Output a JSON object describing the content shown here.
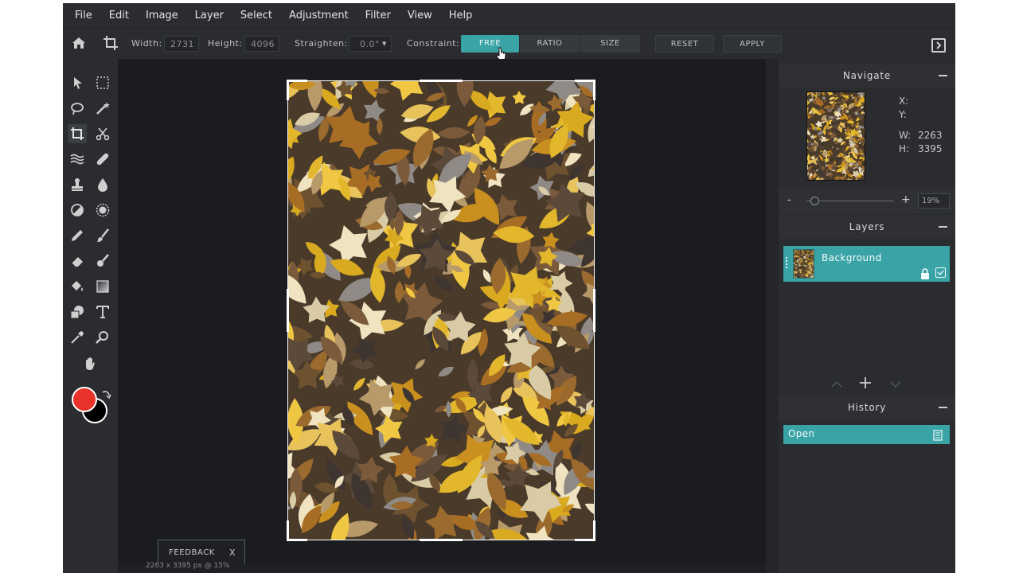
{
  "menu": [
    "File",
    "Edit",
    "Image",
    "Layer",
    "Select",
    "Adjustment",
    "Filter",
    "View",
    "Help"
  ],
  "options": {
    "width_label": "Width:",
    "width_value": "2731",
    "height_label": "Height:",
    "height_value": "4096",
    "straighten_label": "Straighten:",
    "straighten_value": "0.0°",
    "constraint_label": "Constraint:",
    "free": "FREE",
    "ratio": "RATIO",
    "size": "SIZE",
    "reset": "RESET",
    "apply": "APPLY"
  },
  "navigate": {
    "title": "Navigate",
    "x_label": "X:",
    "y_label": "Y:",
    "w_label": "W:",
    "w_value": "2263",
    "h_label": "H:",
    "h_value": "3395",
    "zoom_minus": "-",
    "zoom_plus": "+",
    "zoom_value": "19%",
    "zoom_level": 0.05
  },
  "layers": {
    "title": "Layers",
    "items": [
      {
        "name": "Background",
        "locked": true,
        "visible": true
      }
    ]
  },
  "history": {
    "title": "History",
    "items": [
      "Open"
    ]
  },
  "feedback": {
    "label": "FEEDBACK",
    "close": "X"
  },
  "status": "2263 x 3395 px @ 15%",
  "colors": {
    "foreground": "#e8322a",
    "background": "#000000",
    "accent": "#3aa3a6"
  },
  "tools": [
    "pointer-icon",
    "marquee-icon",
    "lasso-icon",
    "magic-wand-icon",
    "crop-icon",
    "scissors-icon",
    "liquify-icon",
    "bandage-icon",
    "stamp-icon",
    "drop-icon",
    "dodge-icon",
    "sponge-icon",
    "pencil-icon",
    "brush-icon",
    "eraser-icon",
    "smudge-icon",
    "bucket-icon",
    "gradient-icon",
    "shape-icon",
    "text-icon",
    "eyedropper-icon",
    "zoom-icon",
    "hand-icon"
  ]
}
